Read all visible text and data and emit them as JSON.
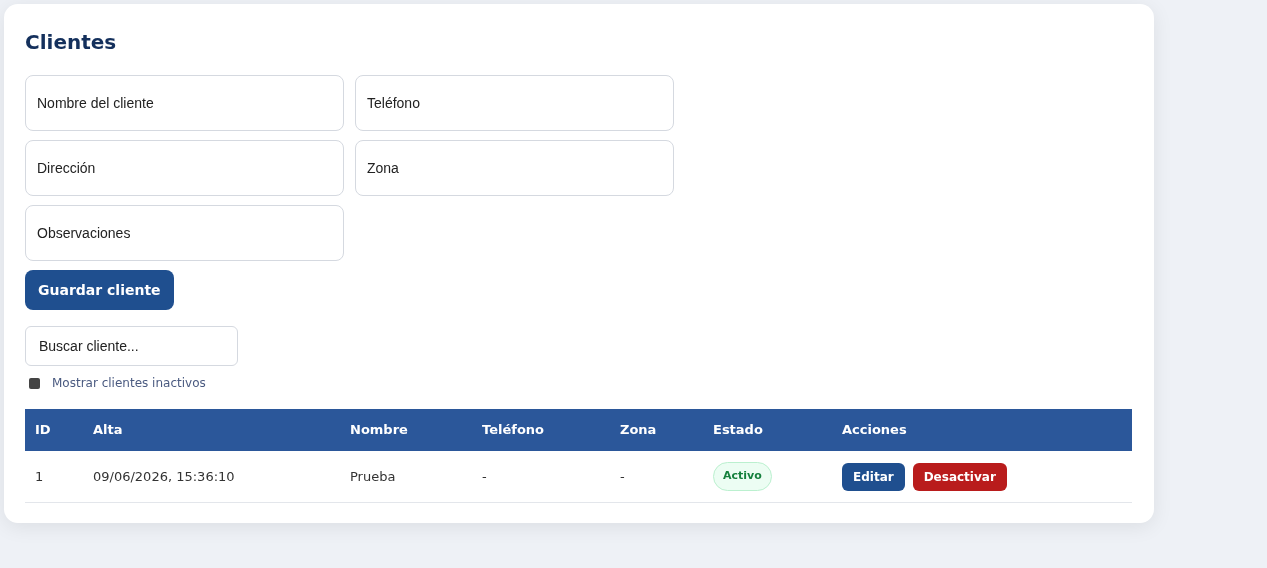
{
  "title": "Clientes",
  "form_fields": [
    {
      "placeholder": "Nombre del cliente"
    },
    {
      "placeholder": "Teléfono"
    },
    {
      "placeholder": "Dirección"
    },
    {
      "placeholder": "Zona"
    },
    {
      "placeholder": "Observaciones"
    }
  ],
  "save_button": "Guardar cliente",
  "search": {
    "placeholder": "Buscar cliente..."
  },
  "show_inactive": {
    "label": "Mostrar clientes inactivos",
    "checked": false
  },
  "table": {
    "columns": [
      "ID",
      "Alta",
      "Nombre",
      "Teléfono",
      "Zona",
      "Estado",
      "Acciones"
    ],
    "rows": [
      {
        "id": "1",
        "alta": "09/06/2026, 15:36:10",
        "nombre": "Prueba",
        "telefono": "-",
        "zona": "-",
        "estado": {
          "label": "Activo",
          "kind": "active"
        },
        "actions": [
          {
            "label": "Editar",
            "kind": "edit"
          },
          {
            "label": "Desactivar",
            "kind": "danger"
          }
        ]
      }
    ]
  }
}
